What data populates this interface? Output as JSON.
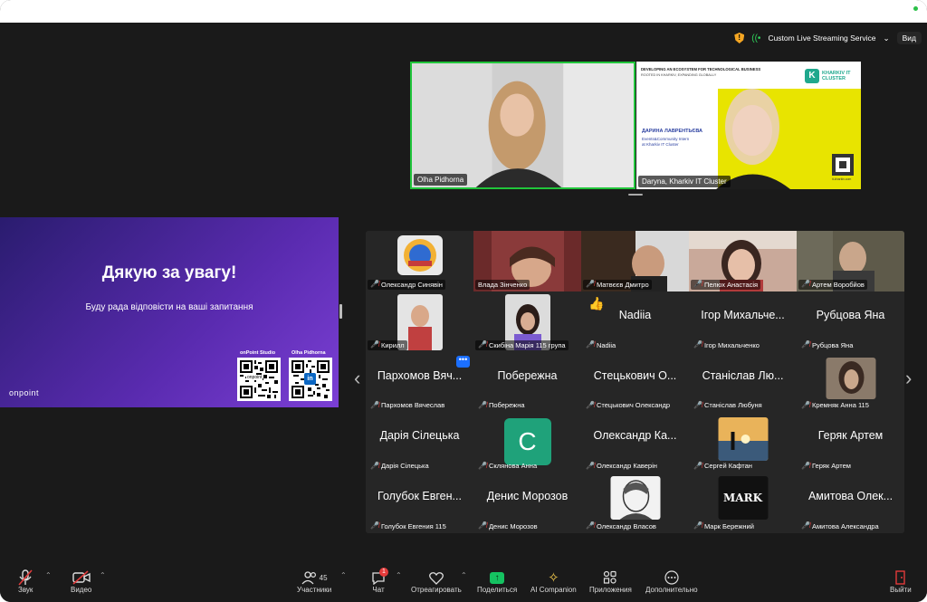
{
  "top_bar": {
    "streaming_label": "Custom Live Streaming Service",
    "view_label": "Вид"
  },
  "videos": [
    {
      "name": "Olha Pidhorna"
    },
    {
      "name": "Daryna, Kharkiv IT Cluster",
      "slide_heading": "DEVELOPING AN ECOSYSTEM FOR TECHNOLOGICAL BUSINESS",
      "slide_subheading": "ROOTED IN KHARKIV, EXPANDING GLOBALLY",
      "brand": "KHARKIV IT CLUSTER",
      "person_name": "ДАРИНА ЛАВРЕНТЬЄВА",
      "person_role1": "Events&Community Intern",
      "person_role2": "at Kharkiv IT Cluster",
      "site": "it-kharkiv.com"
    }
  ],
  "presentation": {
    "title": "Дякую за увагу!",
    "subtitle": "Буду рада відповісти на ваші запитання",
    "logo": "onpoint",
    "qr1_label": "onPoint Studio",
    "qr1_logo": "onpoint",
    "qr2_label": "Olha Pidhorna",
    "qr2_logo": "in"
  },
  "participants": [
    {
      "label": "Олександр Синявін",
      "kind": "photo"
    },
    {
      "label": "Влада Зінченко",
      "kind": "photo"
    },
    {
      "label": "Матвєєв Дмитро",
      "kind": "photo"
    },
    {
      "label": "Пелюх Анастасія",
      "kind": "photo"
    },
    {
      "label": "Артем Воробйов",
      "kind": "photo"
    },
    {
      "label": "Кирилл",
      "kind": "photo"
    },
    {
      "label": "Скибіна Марія 115 група",
      "kind": "photo"
    },
    {
      "label": "Nadiia",
      "big": "Nadiia",
      "kind": "name"
    },
    {
      "label": "Ігор Михальченко",
      "big": "Ігор Михальче...",
      "kind": "name"
    },
    {
      "label": "Рубцова Яна",
      "big": "Рубцова Яна",
      "kind": "name"
    },
    {
      "label": "Пархомов Вячеслав",
      "big": "Пархомов Вяч...",
      "kind": "name"
    },
    {
      "label": "Побережна",
      "big": "Побережна",
      "kind": "name"
    },
    {
      "label": "Стецькович Олександр",
      "big": "Стецькович О...",
      "kind": "name"
    },
    {
      "label": "Станіслав Любуня",
      "big": "Станіслав Лю...",
      "kind": "name"
    },
    {
      "label": "Кремняк Анна 115",
      "kind": "photo"
    },
    {
      "label": "Дарія Сілецька",
      "big": "Дарія Сілецька",
      "kind": "name"
    },
    {
      "label": "Склянова Анна",
      "avatar": "C",
      "kind": "avatar"
    },
    {
      "label": "Олександр Каверін",
      "big": "Олександр Ка...",
      "kind": "name"
    },
    {
      "label": "Сергей Кафтан",
      "kind": "photo"
    },
    {
      "label": "Геряк Артем",
      "big": "Геряк Артем",
      "kind": "name"
    },
    {
      "label": "Голубок Евгения 115",
      "big": "Голубок Евген...",
      "kind": "name"
    },
    {
      "label": "Денис Морозов",
      "big": "Денис Морозов",
      "kind": "name"
    },
    {
      "label": "Олександр Власов",
      "kind": "photo"
    },
    {
      "label": "Марк Бережний",
      "logo_text": "MARK",
      "kind": "photo"
    },
    {
      "label": "Амитова Александра",
      "big": "Амитова Олек...",
      "kind": "name"
    }
  ],
  "toolbar": {
    "audio": "Звук",
    "video": "Видео",
    "participants": "Участники",
    "participants_count": "45",
    "chat": "Чат",
    "chat_badge": "1",
    "react": "Отреагировать",
    "share": "Поделиться",
    "ai": "AI Companion",
    "apps": "Приложения",
    "more": "Дополнительно",
    "leave": "Выйти"
  },
  "colors": {
    "accent_green": "#21c53b",
    "muted_red": "#e23b3b",
    "share_green": "#15c261"
  }
}
